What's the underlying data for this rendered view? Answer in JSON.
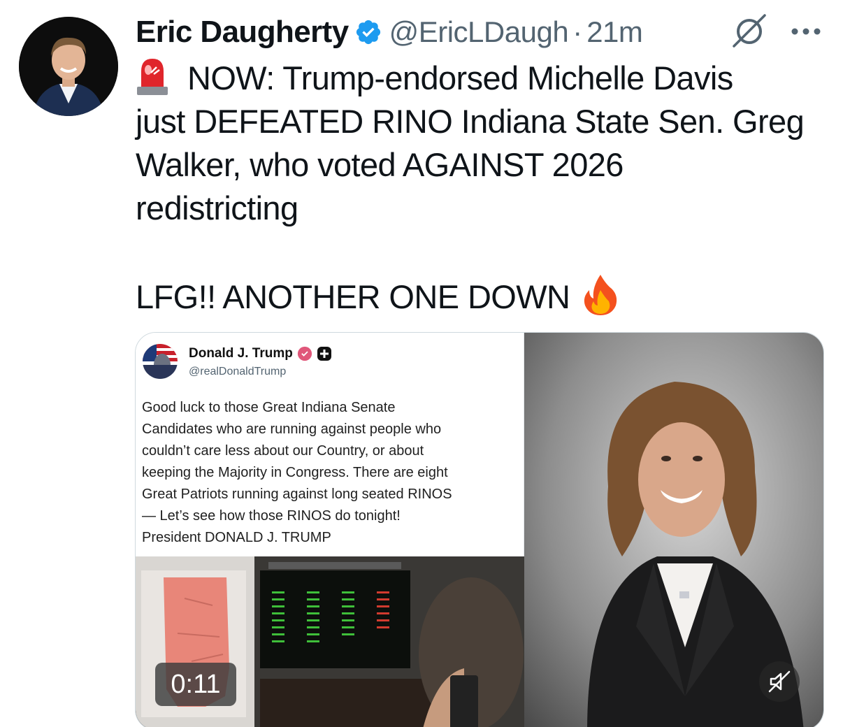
{
  "tweet": {
    "author": {
      "name": "Eric Daugherty",
      "handle": "@EricLDaugh",
      "verified": true
    },
    "separator": "·",
    "timestamp": "21m",
    "text_lines": [
      "NOW: Trump-endorsed Michelle Davis",
      "just DEFEATED RINO Indiana State Sen. Greg",
      "Walker, who voted AGAINST 2026",
      "redistricting",
      "LFG!! ANOTHER ONE DOWN"
    ],
    "emojis": [
      "siren-icon",
      "fire-icon"
    ]
  },
  "media": {
    "embedded_post": {
      "name": "Donald J. Trump",
      "handle": "@realDonaldTrump",
      "body_lines": [
        "Good luck to those Great Indiana Senate",
        "Candidates who are running against people who",
        "couldn’t care less about our Country, or about",
        "keeping the Majority in Congress. There are eight",
        "Great Patriots running against long seated RINOS",
        "— Let’s see how those RINOS do tonight!",
        "President DONALD J. TRUMP"
      ]
    },
    "video": {
      "duration": "0:11"
    }
  },
  "colors": {
    "verified_blue": "#1d9bf0",
    "secondary_text": "#536471",
    "border": "#cfd9de"
  }
}
